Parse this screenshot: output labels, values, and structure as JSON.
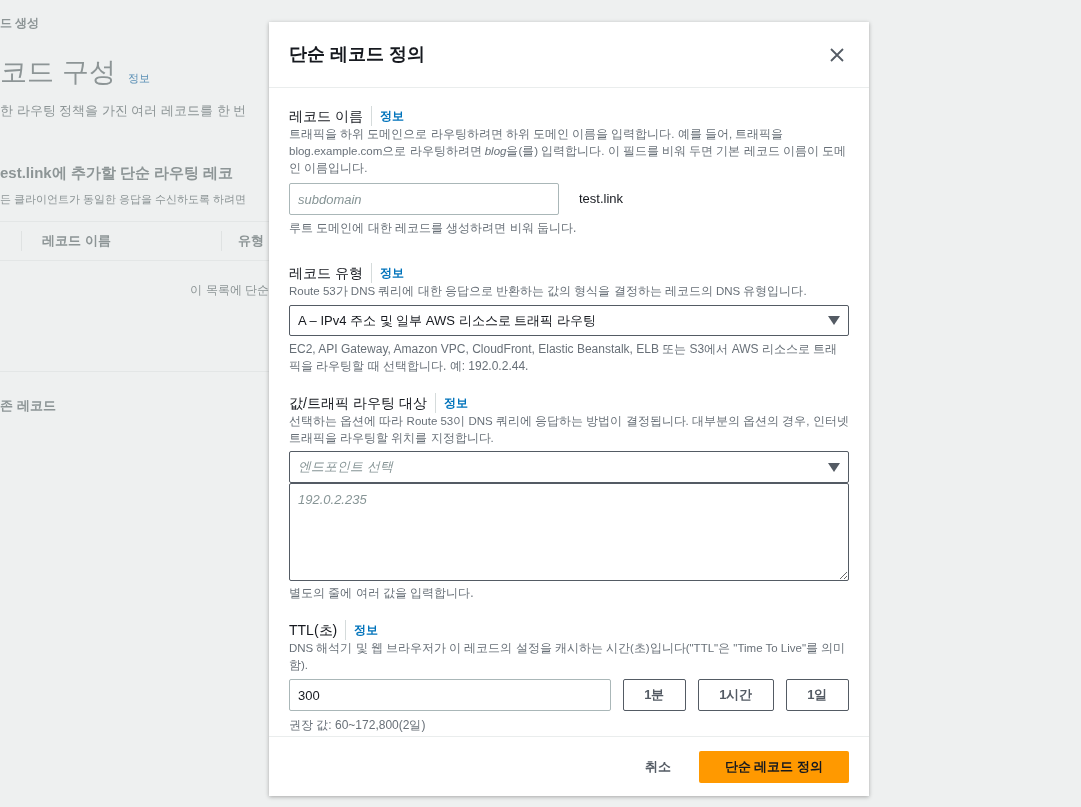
{
  "background": {
    "breadcrumb": "드 생성",
    "heading": "코드 구성",
    "heading_info": "정보",
    "description": "한 라우팅 정책을 가진 여러 레코드를 한 번",
    "section_title": "est.link에 추가할 단순 라우팅 레코",
    "section_description": "든 클라이언트가 동일한 응답을 수신하도록 하려면",
    "table_columns": [
      "레코드 이름",
      "유형"
    ],
    "empty_message": "이 목록에 단순",
    "existing_records": "존 레코드"
  },
  "dialog": {
    "title": "단순 레코드 정의",
    "record_name": {
      "label": "레코드 이름",
      "info": "정보",
      "description": [
        {
          "text": "트래픽을 하위 도메인으로 라우팅하려면 하위 도메인 이름을 입력합니다. 예를 들어, 트래픽을 blog.example.com으로 라우팅하려면 ",
          "italic": false
        },
        {
          "text": "blog",
          "italic": true
        },
        {
          "text": "을(를) 입력합니다. 이 필드를 비워 두면 기본 레코드 이름이 도메인 이름입니다.",
          "italic": false
        }
      ],
      "placeholder": "subdomain",
      "suffix": "test.link",
      "hint": "루트 도메인에 대한 레코드를 생성하려면 비워 둡니다."
    },
    "record_type": {
      "label": "레코드 유형",
      "info": "정보",
      "description": "Route 53가 DNS 쿼리에 대한 응답으로 반환하는 값의 형식을 결정하는 레코드의 DNS 유형입니다.",
      "value": "A – IPv4 주소 및 일부 AWS 리소스로 트래픽 라우팅",
      "hint": "EC2, API Gateway, Amazon VPC, CloudFront, Elastic Beanstalk, ELB 또는 S3에서 AWS 리소스로 트래픽을 라우팅할 때 선택합니다. 예: 192.0.2.44."
    },
    "route_target": {
      "label": "값/트래픽 라우팅 대상",
      "info": "정보",
      "description": "선택하는 옵션에 따라 Route 53이 DNS 쿼리에 응답하는 방법이 결정됩니다. 대부분의 옵션의 경우, 인터넷 트래픽을 라우팅할 위치를 지정합니다.",
      "endpoint_placeholder": "엔드포인트 선택",
      "values_placeholder": "192.0.2.235",
      "hint": "별도의 줄에 여러 값을 입력합니다."
    },
    "ttl": {
      "label": "TTL(초)",
      "info": "정보",
      "description": "DNS 해석기 및 웹 브라우저가 이 레코드의 설정을 캐시하는 시간(초)입니다(\"TTL\"은 \"Time To Live\"를 의미함).",
      "value": "300",
      "presets": [
        "1분",
        "1시간",
        "1일"
      ],
      "hint": "권장 값: 60~172,800(2일)"
    },
    "cancel": "취소",
    "submit": "단순 레코드 정의"
  }
}
